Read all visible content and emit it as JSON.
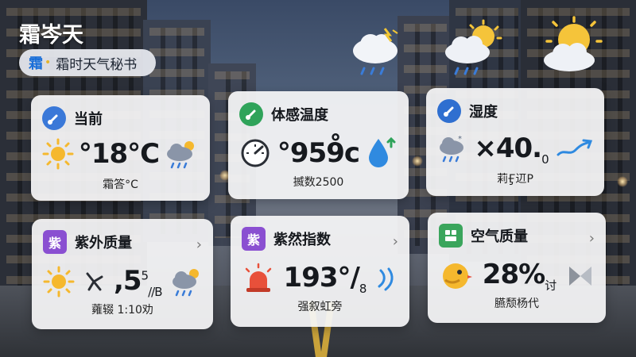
{
  "header": {
    "app_title": "霜岑天",
    "brand_logo": "霜",
    "brand_name": "霜时天气秘书"
  },
  "cards": {
    "current": {
      "title": "当前",
      "value": "°18°C",
      "detail": "霜答°C",
      "accent": "#3a78d8"
    },
    "feels_like": {
      "title": "体感温度",
      "value": "°959̊c",
      "detail": "揻数2500",
      "accent": "#2fa35a"
    },
    "humidity": {
      "title": "湿度",
      "value": "×40.",
      "value_suffix": "0",
      "detail": "莉Ӻ䢋P",
      "accent": "#2f6fd0"
    },
    "uv": {
      "title": "紫外质量",
      "badge_text": "紫",
      "value": ",5",
      "value_sup": "5",
      "value_sub": "//B",
      "detail": "蕹辍 1:10劝",
      "accent": "#8a4fd1"
    },
    "index": {
      "title": "紫然指数",
      "badge_text": "紫",
      "value": "193°/",
      "value_sub": "8",
      "detail": "强叙虹旁",
      "accent": "#8a4fd1"
    },
    "air": {
      "title": "空气质量",
      "value": "28%",
      "value_suffix": "讨",
      "detail": "臙颓杨代",
      "accent": "#3aa55c"
    }
  },
  "icons": {
    "top_left": "cloud-rain-lightning-icon",
    "top_mid": "sun-cloud-rain-icon",
    "top_right": "sun-cloud-icon"
  }
}
